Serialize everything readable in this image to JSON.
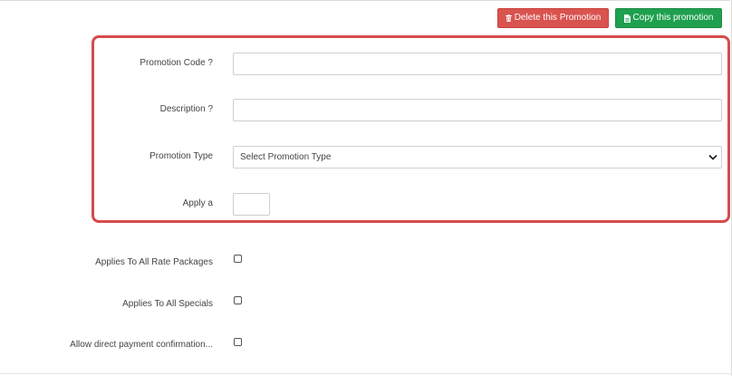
{
  "toolbar": {
    "delete_label": "Delete this Promotion",
    "copy_label": "Copy this promotion"
  },
  "form": {
    "promotion_code": {
      "label": "Promotion Code ?",
      "value": "",
      "placeholder": ""
    },
    "description": {
      "label": "Description ?",
      "value": "",
      "placeholder": ""
    },
    "promotion_type": {
      "label": "Promotion Type",
      "selected": "Select Promotion Type"
    },
    "apply": {
      "label": "Apply a",
      "value": ""
    },
    "applies_to_all_rate_packages": {
      "label": "Applies To All Rate Packages",
      "checked": false
    },
    "applies_to_all_specials": {
      "label": "Applies To All Specials",
      "checked": false
    },
    "allow_direct_payment": {
      "label": "Allow direct payment confirmation...",
      "checked": false
    }
  },
  "colors": {
    "delete_button": "#d9534f",
    "copy_button": "#1fa04f",
    "highlight_border": "#d64b4b"
  },
  "icons": {
    "delete": "trash-icon",
    "copy": "document-icon",
    "select": "chevron-down-icon"
  }
}
